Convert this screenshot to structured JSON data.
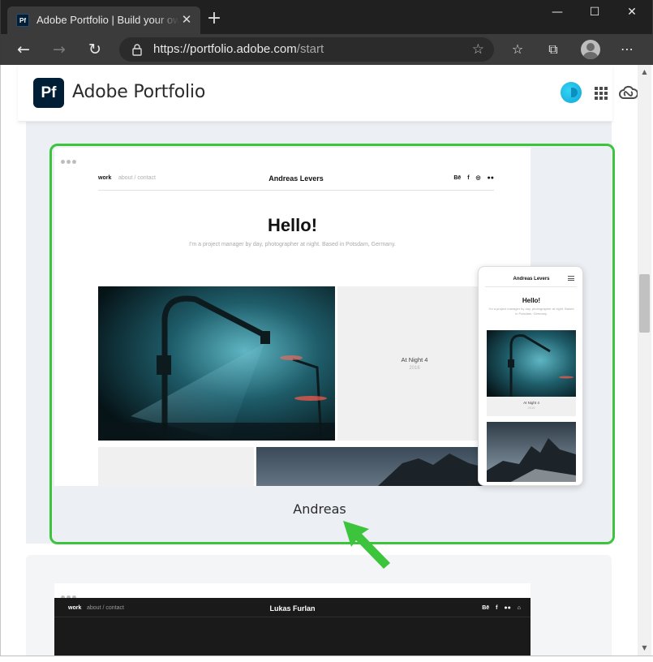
{
  "browser": {
    "tab_title": "Adobe Portfolio | Build your own personalized website",
    "tab_favicon": "Pf",
    "url_host": "https://portfolio.adobe.com",
    "url_path": "/start",
    "icons": [
      "back-arrow-icon",
      "forward-arrow-icon",
      "refresh-icon",
      "lock-icon",
      "star-icon",
      "favorites-icon",
      "collections-icon",
      "profile-icon",
      "more-icon",
      "minimize-icon",
      "maximize-icon",
      "close-icon",
      "new-tab-icon"
    ]
  },
  "app": {
    "logo_text": "Pf",
    "title": "Adobe Portfolio",
    "brand_color": "#001e36"
  },
  "templates": [
    {
      "label": "Andreas",
      "highlight_color": "#3dc43d",
      "preview": {
        "nav_work": "work",
        "nav_links": "about / contact",
        "site_name": "Andreas Levers",
        "social": "Bē f ◎ ●●",
        "heading": "Hello!",
        "tagline": "I'm a project manager by day, photographer at night. Based in Potsdam, Germany.",
        "project_title": "At Night 4",
        "project_year": "2016"
      },
      "mobile": {
        "site_name": "Andreas Levers",
        "heading": "Hello!",
        "tagline": "I'm a project manager by day, photographer at night. Based in Potsdam, Germany.",
        "project_title": "At Night 4",
        "project_year": "2016"
      }
    },
    {
      "preview": {
        "nav_work": "work",
        "nav_links": "about / contact",
        "site_name": "Lukas Furlan",
        "social": "Bē f ●● ⌂"
      }
    }
  ]
}
